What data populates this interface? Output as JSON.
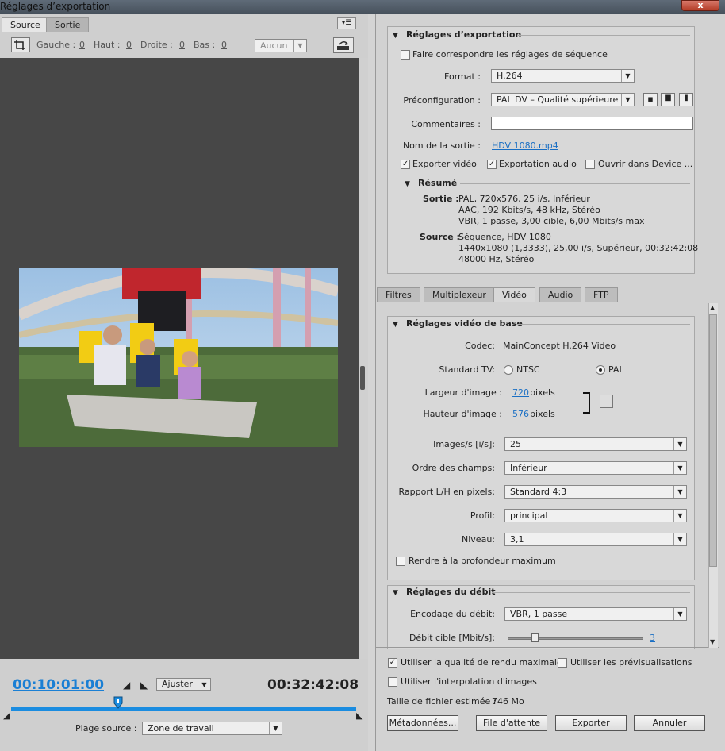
{
  "window": {
    "title": "Réglages d’exportation",
    "close": "x"
  },
  "left": {
    "tabs": [
      "Source",
      "Sortie"
    ],
    "crop": {
      "gauche_label": "Gauche :",
      "gauche_val": "0",
      "haut_label": "Haut :",
      "haut_val": "0",
      "droite_label": "Droite :",
      "droite_val": "0",
      "bas_label": "Bas :",
      "bas_val": "0",
      "aspect": "Aucun"
    },
    "timeline": {
      "current": "00:10:01:00",
      "total": "00:32:42:08",
      "zoom": "Ajuster",
      "playhead_fraction": 0.31
    },
    "plage_label": "Plage source :",
    "plage_value": "Zone de travail"
  },
  "export": {
    "section": "Réglages d’exportation",
    "match_seq": "Faire correspondre les réglages de séquence",
    "format_label": "Format :",
    "format": "H.264",
    "preset_label": "Préconfiguration :",
    "preset": "PAL DV – Qualité supérieure",
    "comments_label": "Commentaires :",
    "comments": "",
    "output_label": "Nom de la sortie :",
    "output": "HDV 1080.mp4",
    "export_video": "Exporter vidéo",
    "export_audio": "Exportation audio",
    "open_device": "Ouvrir dans Device ...",
    "resume": "Résumé",
    "sortie_label": "Sortie :",
    "sortie_lines": [
      "PAL, 720x576, 25 i/s, Inférieur",
      "AAC, 192 Kbits/s, 48 kHz, Stéréo",
      "VBR, 1 passe, 3,00 cible, 6,00 Mbits/s max"
    ],
    "source_label": "Source :",
    "source_lines": [
      "Séquence, HDV 1080",
      "1440x1080 (1,3333), 25,00 i/s, Supérieur, 00:32:42:08",
      "48000 Hz, Stéréo"
    ]
  },
  "tabs2": [
    "Filtres",
    "Multiplexeur",
    "Vidéo",
    "Audio",
    "FTP"
  ],
  "video": {
    "section": "Réglages vidéo de base",
    "codec_label": "Codec:",
    "codec": "MainConcept H.264 Video",
    "tv_label": "Standard TV:",
    "ntsc": "NTSC",
    "pal": "PAL",
    "width_label": "Largeur d'image :",
    "width": "720",
    "height_label": "Hauteur d'image :",
    "height": "576",
    "unit": "pixels",
    "fps_label": "Images/s [i/s]:",
    "fps": "25",
    "fields_label": "Ordre des champs:",
    "fields": "Inférieur",
    "par_label": "Rapport L/H en pixels:",
    "par": "Standard 4:3",
    "profile_label": "Profil:",
    "profile": "principal",
    "level_label": "Niveau:",
    "level": "3,1",
    "max_depth": "Rendre à la profondeur maximum",
    "bitrate_section": "Réglages du débit",
    "encoding_label": "Encodage du débit:",
    "encoding": "VBR, 1 passe",
    "target_label": "Débit cible [Mbit/s]:",
    "target": "3",
    "target_fraction": 0.2
  },
  "bottom": {
    "max_quality": "Utiliser la qualité de rendu maximale",
    "use_previews": "Utiliser les prévisualisations",
    "interp": "Utiliser l'interpolation d'images",
    "size_label": "Taille de fichier estimée :",
    "size": "746 Mo",
    "metadata": "Métadonnées...",
    "queue": "File d'attente",
    "export": "Exporter",
    "cancel": "Annuler"
  }
}
